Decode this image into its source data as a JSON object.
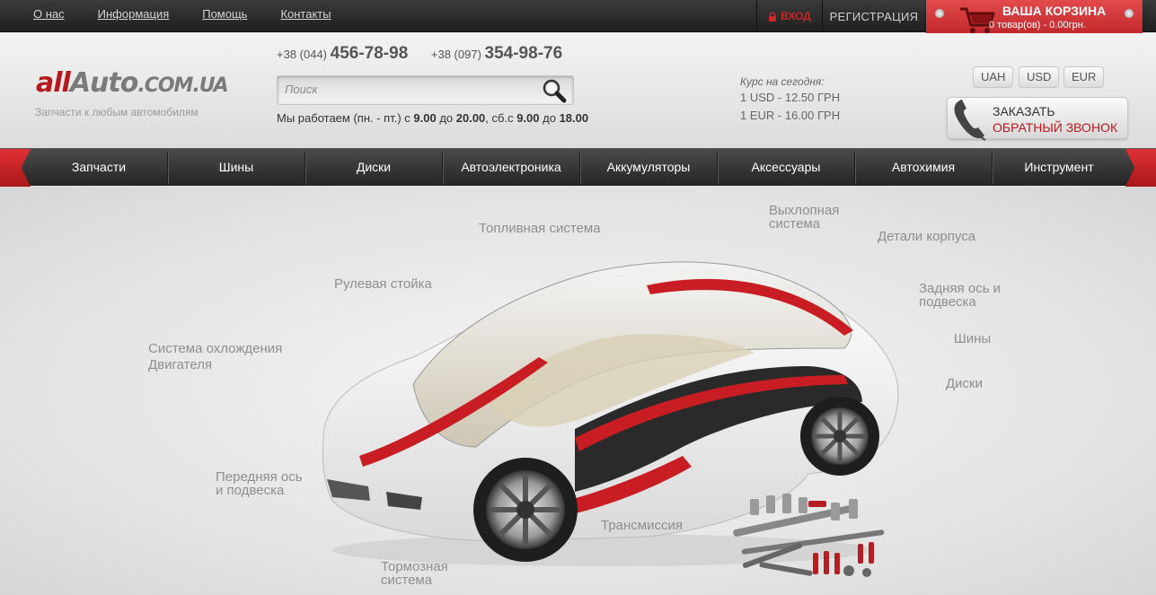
{
  "top_links": [
    "О нас",
    "Информация",
    "Помощь",
    "Контакты"
  ],
  "login_label": "ВХОД",
  "register_label": "РЕГИСТРАЦИЯ",
  "cart": {
    "title": "ВАША КОРЗИНА",
    "summary": "0 товар(ов) - 0.00грн."
  },
  "logo": {
    "part1": "all",
    "part2": "Auto",
    "part3": ".COM.UA"
  },
  "slogan": "Запчасти к любым автомобилям",
  "phones": [
    {
      "prefix": "+38 (044)",
      "number": "456-78-98"
    },
    {
      "prefix": "+38 (097)",
      "number": "354-98-76"
    }
  ],
  "search": {
    "placeholder": "Поиск"
  },
  "hours": {
    "t1": "Мы работаем (пн. - пт.) с ",
    "h1": "9.00",
    "t2": " до ",
    "h2": "20.00",
    "t3": ", сб.с ",
    "h3": "9.00",
    "t4": " до ",
    "h4": "18.00"
  },
  "rates": {
    "title": "Курс на сегодня:",
    "usd": "1 USD - 12.50 ГРН",
    "eur": "1 EUR - 16.00 ГРН"
  },
  "currencies": [
    "UAH",
    "USD",
    "EUR"
  ],
  "callback": {
    "line1": "ЗАКАЗАТЬ",
    "line2": "ОБРАТНЫЙ ЗВОНОК"
  },
  "nav": [
    "Запчасти",
    "Шины",
    "Диски",
    "Автоэлектроника",
    "Аккумуляторы",
    "Аксессуары",
    "Автохимия",
    "Инструмент"
  ],
  "hero_labels": {
    "fuel": "Топливная система",
    "exhaust1": "Выхлопная",
    "exhaust2": "система",
    "body": "Детали корпуса",
    "steering": "Рулевая стойка",
    "rear1": "Задняя ось и",
    "rear2": "подвеска",
    "cooling1": "Система охлождения",
    "cooling2": "Двигателя",
    "tires": "Шины",
    "wheels": "Диски",
    "front1": "Передняя ось",
    "front2": "и подвеска",
    "transmission": "Трансмиссия",
    "brakes1": "Тормозная",
    "brakes2": "система"
  },
  "colors": {
    "accent": "#b6191d",
    "dark": "#2a2a2a"
  }
}
